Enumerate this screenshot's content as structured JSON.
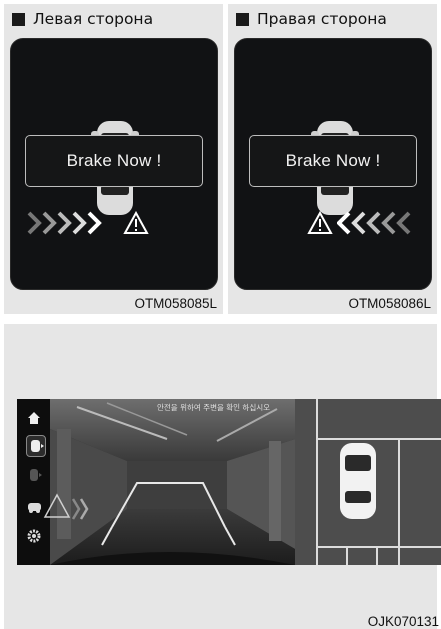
{
  "left_panel": {
    "title": "Левая сторона",
    "alert": "Brake Now !",
    "figure_code": "OTM058085L"
  },
  "right_panel": {
    "title": "Правая сторона",
    "alert": "Brake Now !",
    "figure_code": "OTM058086L"
  },
  "camera_panel": {
    "overlay_text": "안전을 위하여 주변을 확인 하십시오",
    "figure_code": "OJK070131",
    "side_icons": [
      "home-icon",
      "rear-camera-icon",
      "side-camera-icon",
      "car-view-icon",
      "settings-icon"
    ]
  },
  "colors": {
    "panel_bg": "#e6e6e6",
    "screen_bg": "#111214",
    "guide_line": "#e8e8e8"
  }
}
